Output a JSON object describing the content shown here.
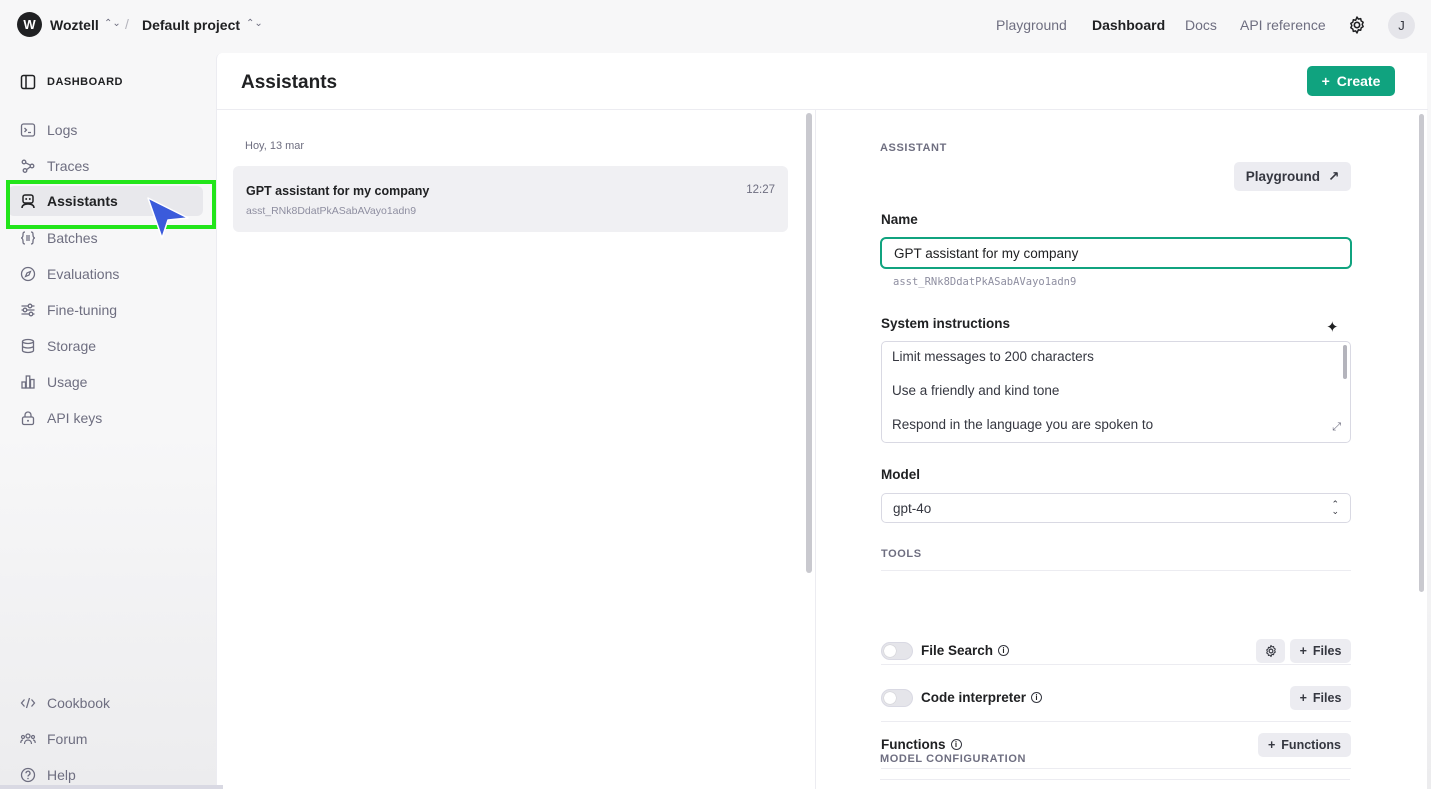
{
  "topbar": {
    "org_initial": "W",
    "org_name": "Woztell",
    "separator": "/",
    "project_name": "Default project",
    "nav": [
      "Playground",
      "Dashboard",
      "Docs",
      "API reference"
    ],
    "active_nav": "Dashboard",
    "user_initial": "J"
  },
  "sidebar": {
    "header": "DASHBOARD",
    "items": [
      {
        "label": "Logs",
        "icon": "terminal-icon"
      },
      {
        "label": "Traces",
        "icon": "traces-icon"
      },
      {
        "label": "Assistants",
        "icon": "robot-icon"
      },
      {
        "label": "Batches",
        "icon": "batches-icon"
      },
      {
        "label": "Evaluations",
        "icon": "compass-icon"
      },
      {
        "label": "Fine-tuning",
        "icon": "sliders-icon"
      },
      {
        "label": "Storage",
        "icon": "database-icon"
      },
      {
        "label": "Usage",
        "icon": "bar-chart-icon"
      },
      {
        "label": "API keys",
        "icon": "lock-icon"
      }
    ],
    "active_item": "Assistants",
    "footer": [
      {
        "label": "Cookbook",
        "icon": "code-icon"
      },
      {
        "label": "Forum",
        "icon": "people-icon"
      },
      {
        "label": "Help",
        "icon": "help-icon"
      }
    ]
  },
  "main": {
    "title": "Assistants",
    "create_label": "Create",
    "list": {
      "date_label": "Hoy, 13 mar",
      "items": [
        {
          "title": "GPT assistant for my company",
          "id": "asst_RNk8DdatPkASabAVayo1adn9",
          "time": "12:27"
        }
      ]
    },
    "detail": {
      "section_label": "ASSISTANT",
      "playground_label": "Playground",
      "name_label": "Name",
      "name_value": "GPT assistant for my company",
      "assistant_id": "asst_RNk8DdatPkASabAVayo1adn9",
      "instructions_label": "System instructions",
      "instructions": [
        "Limit messages to 200 characters",
        "Use a friendly and kind tone",
        "Respond in the language you are spoken to"
      ],
      "model_label": "Model",
      "model_value": "gpt-4o",
      "tools_label": "TOOLS",
      "tools": {
        "file_search": "File Search",
        "code_interpreter": "Code interpreter",
        "functions": "Functions",
        "files_label": "Files",
        "functions_btn": "Functions"
      },
      "model_config_label": "MODEL CONFIGURATION"
    }
  },
  "colors": {
    "accent": "#10a37f",
    "highlight": "#22e51a",
    "cursor": "#3b5bdb"
  }
}
